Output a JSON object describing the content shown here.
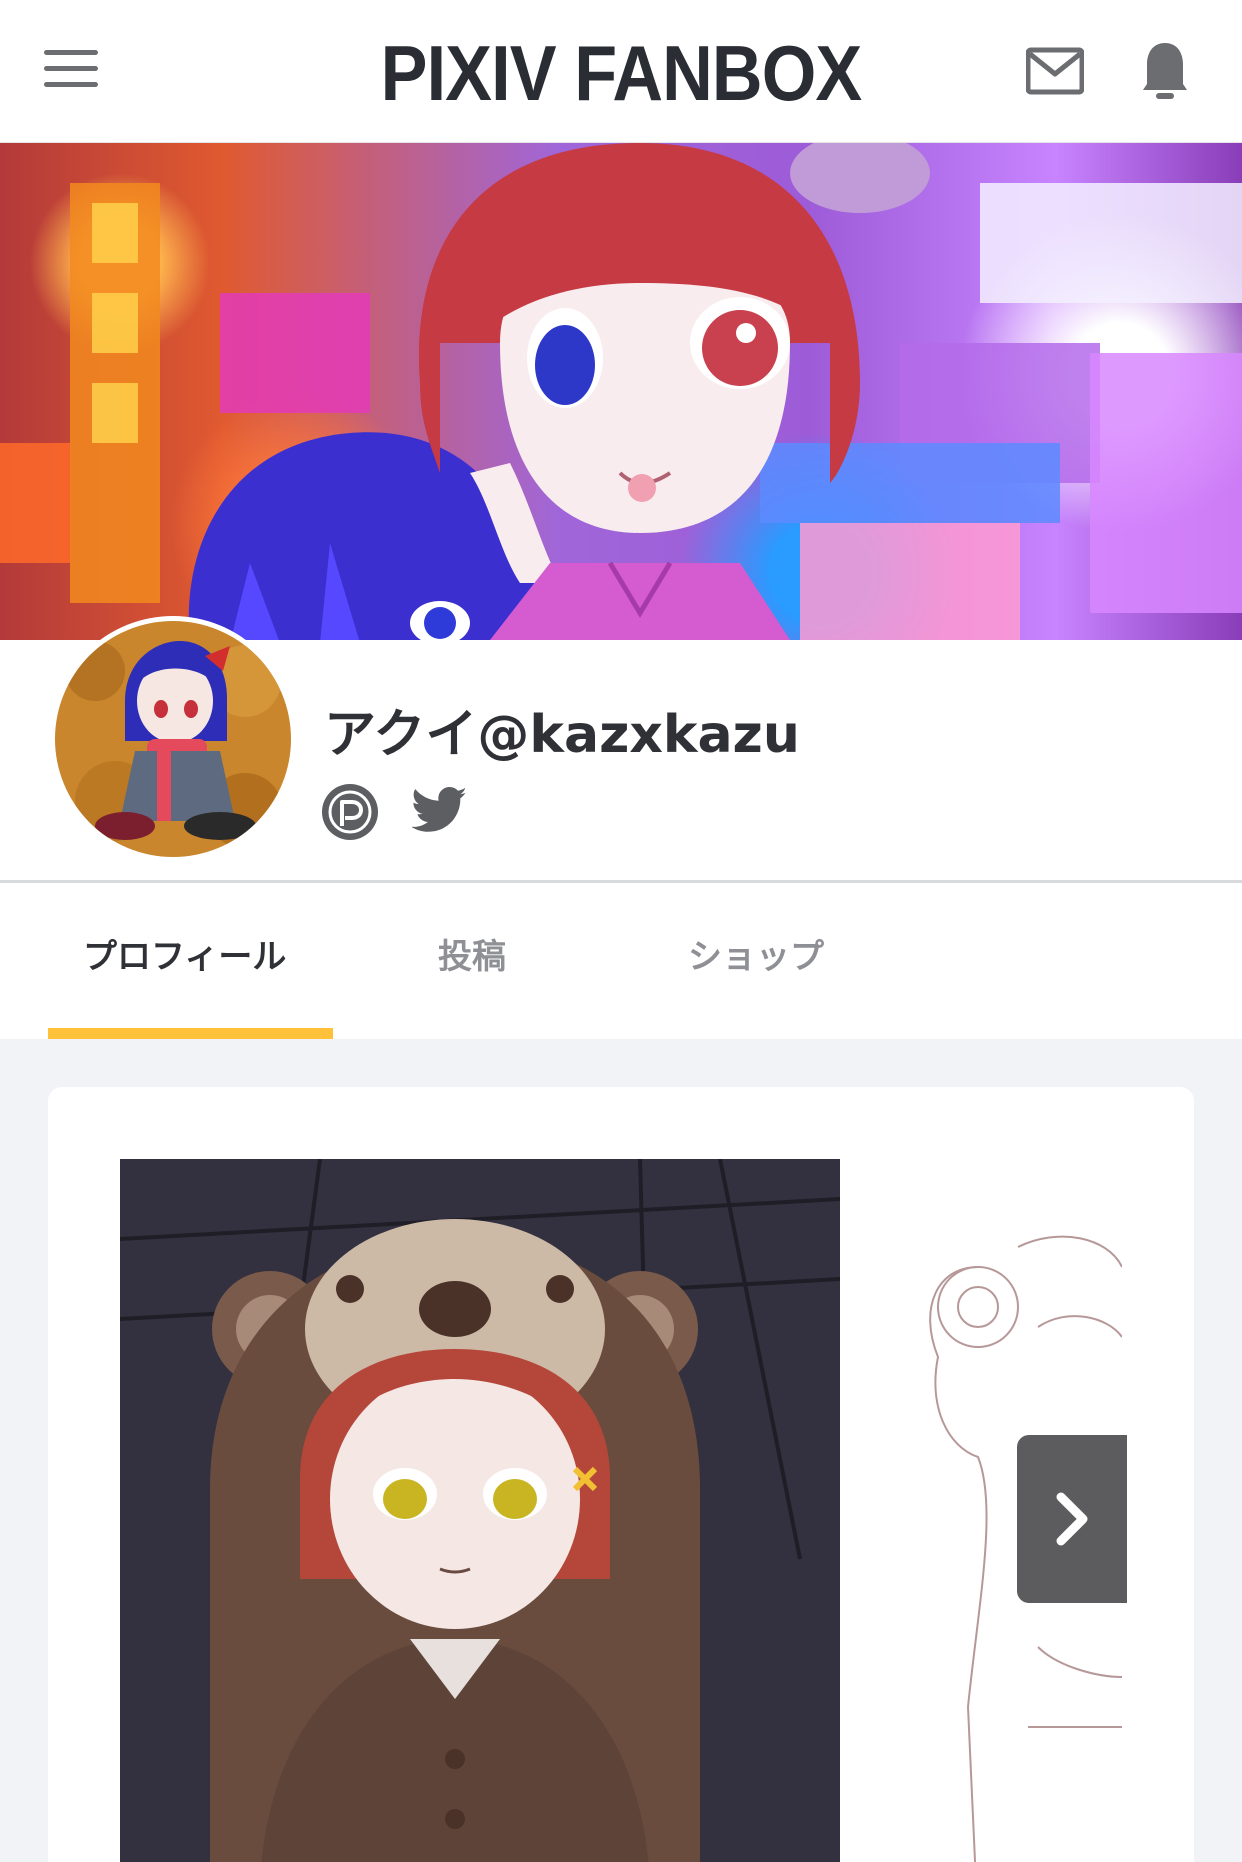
{
  "header": {
    "logo": "PIXIV FANBOX",
    "icons": {
      "menu": "hamburger-menu-icon",
      "messages": "mail-icon",
      "notifications": "bell-icon"
    },
    "icon_color": "#6b6d71"
  },
  "creator": {
    "name": "アクイ@kazxkazu",
    "links": [
      {
        "icon": "pixiv-icon"
      },
      {
        "icon": "twitter-icon"
      }
    ]
  },
  "tabs": {
    "items": [
      {
        "label": "プロフィール",
        "active": true
      },
      {
        "label": "投稿",
        "active": false
      },
      {
        "label": "ショップ",
        "active": false
      }
    ],
    "indicator_color": "#ffc03a"
  },
  "gallery": {
    "next_icon": "chevron-right-icon"
  }
}
